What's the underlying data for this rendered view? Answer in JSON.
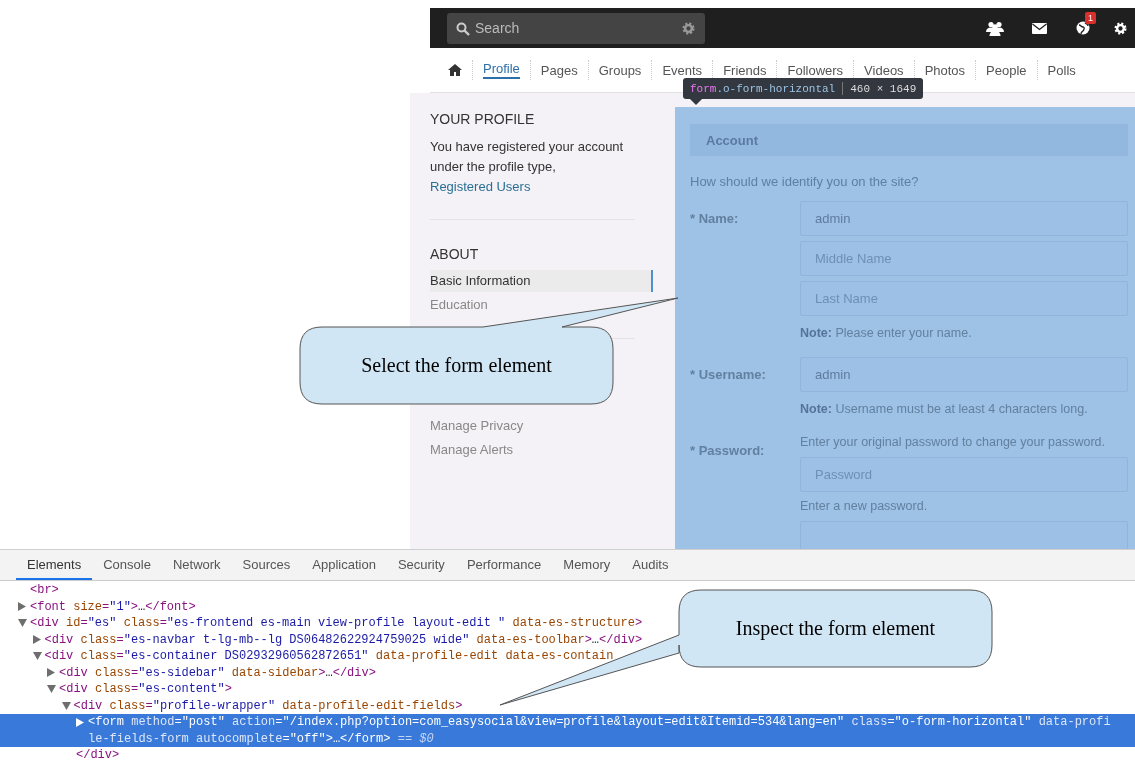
{
  "navbar": {
    "search": {
      "placeholder": "Search"
    },
    "notification_badge": "1"
  },
  "tabs": [
    {
      "kind": "home",
      "selected": false
    },
    {
      "kind": "text",
      "label": "Profile",
      "selected": true
    },
    {
      "kind": "text",
      "label": "Pages",
      "selected": false
    },
    {
      "kind": "text",
      "label": "Groups",
      "selected": false
    },
    {
      "kind": "text",
      "label": "Events",
      "selected": false
    },
    {
      "kind": "text",
      "label": "Friends",
      "selected": false
    },
    {
      "kind": "text",
      "label": "Followers",
      "selected": false
    },
    {
      "kind": "text",
      "label": "Videos",
      "selected": false
    },
    {
      "kind": "text",
      "label": "Photos",
      "selected": false
    },
    {
      "kind": "text",
      "label": "People",
      "selected": false
    },
    {
      "kind": "text",
      "label": "Polls",
      "selected": false
    }
  ],
  "inspector_tooltip": {
    "selector": "form.o-form-horizontal",
    "size": "460 × 1649"
  },
  "sidebar": {
    "sections": [
      {
        "heading": "YOUR PROFILE",
        "text": "You have registered your account under the profile type, ",
        "link": "Registered Users"
      },
      {
        "heading": "ABOUT",
        "items": [
          {
            "label": "Basic Information",
            "selected": true
          },
          {
            "label": "Education",
            "selected": false
          }
        ]
      },
      {
        "items": [
          {
            "label": "Manage Privacy",
            "selected": false
          },
          {
            "label": "Manage Alerts",
            "selected": false
          }
        ]
      }
    ]
  },
  "form": {
    "section": "Account",
    "description": "How should we identify you on the site?",
    "fields": [
      {
        "label": "* Name:",
        "rows": [
          {
            "kind": "input",
            "value": "admin"
          },
          {
            "kind": "input",
            "placeholder": "Middle Name"
          },
          {
            "kind": "input",
            "placeholder": "Last Name"
          },
          {
            "kind": "note",
            "text": "**Note:** Please enter your name."
          }
        ]
      },
      {
        "label": "* Username:",
        "rows": [
          {
            "kind": "input",
            "value": "admin"
          },
          {
            "kind": "note",
            "text": "**Note:** Username must be at least 4 characters long."
          }
        ]
      },
      {
        "label": "* Password:",
        "rows": [
          {
            "kind": "help",
            "text": "Enter your original password to change your password."
          },
          {
            "kind": "input",
            "placeholder": "Password"
          },
          {
            "kind": "help",
            "text": "Enter a new password."
          },
          {
            "kind": "input"
          }
        ]
      }
    ]
  },
  "devtools": {
    "tabs": [
      {
        "label": "Elements",
        "selected": true
      },
      {
        "label": "Console",
        "selected": false
      },
      {
        "label": "Network",
        "selected": false
      },
      {
        "label": "Sources",
        "selected": false
      },
      {
        "label": "Application",
        "selected": false
      },
      {
        "label": "Security",
        "selected": false
      },
      {
        "label": "Performance",
        "selected": false
      },
      {
        "label": "Memory",
        "selected": false
      },
      {
        "label": "Audits",
        "selected": false
      }
    ],
    "dom_tree": [
      {
        "markup": "<br>",
        "selected": false
      },
      {
        "markup": "<font size=\"1\">…</font>",
        "expanded": false,
        "selected": false
      },
      {
        "markup": "<div id=\"es\" class=\"es-frontend es-main  view-profile layout-edit \" data-es-structure>",
        "expanded": true,
        "selected": false,
        "children": [
          {
            "markup": "<div class=\"es-navbar t-lg-mb--lg DS06482622924759025 wide\" data-es-toolbar>…</div>",
            "expanded": false,
            "selected": false
          },
          {
            "markup": "<div class=\"es-container DS02932960562872651\" data-profile-edit data-es-contain",
            "expanded": true,
            "selected": false,
            "children": [
              {
                "markup": "<div class=\"es-sidebar\" data-sidebar>…</div>",
                "expanded": false,
                "selected": false
              },
              {
                "markup": "<div class=\"es-content\">",
                "expanded": true,
                "selected": false,
                "children": [
                  {
                    "markup": "<div class=\"profile-wrapper\" data-profile-edit-fields>",
                    "expanded": true,
                    "selected": false,
                    "closing": "</div>",
                    "children": [
                      {
                        "markup": "<form method=\"post\" action=\"/index.php?option=com_easysocial&view=profile&layout=edit&Itemid=534&lang=en\" class=\"o-form-horizontal\" data-profile-fields-form autocomplete=\"off\">…</form> == $0",
                        "expanded": false,
                        "selected": true
                      }
                    ]
                  }
                ]
              }
            ]
          }
        ]
      }
    ]
  },
  "callouts": [
    {
      "text": "Select the form element"
    },
    {
      "text": "Inspect the form element"
    }
  ]
}
